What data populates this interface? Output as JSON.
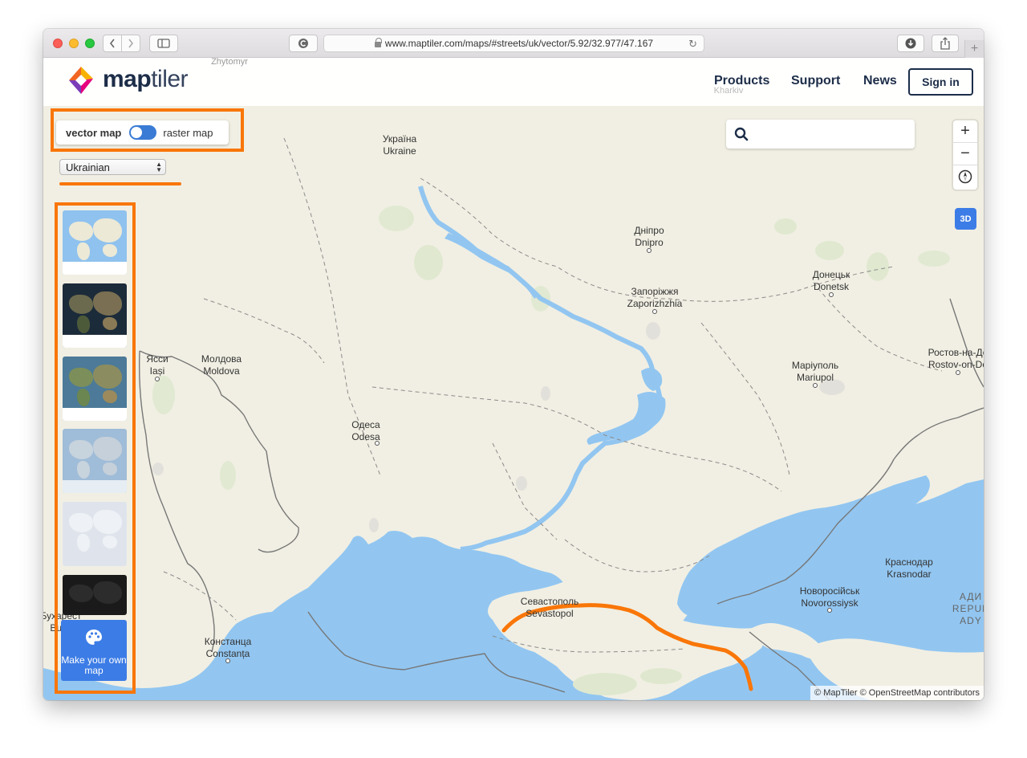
{
  "browser": {
    "url": "www.maptiler.com/maps/#streets/uk/vector/5.92/32.977/47.167"
  },
  "header": {
    "logo_text_bold": "map",
    "logo_text_light": "tiler",
    "nav": [
      "Products",
      "Support",
      "News"
    ],
    "signin_label": "Sign in"
  },
  "controls": {
    "vector_label": "vector map",
    "raster_label": "raster map",
    "language_value": "Ukrainian",
    "make_map_label": "Make your own map",
    "btn_3d": "3D",
    "zoom_in": "+",
    "zoom_out": "−",
    "attribution": "© MapTiler © OpenStreetMap contributors"
  },
  "map_labels": {
    "zhytomyr": "Zhytomyr",
    "kharkiv": "Kharkiv",
    "ukraine_uk": "Україна",
    "ukraine_en": "Ukraine",
    "dnipro_uk": "Дніпро",
    "dnipro_en": "Dnipro",
    "zaporizhzhia_uk": "Запоріжжя",
    "zaporizhzhia_en": "Zaporizhzhia",
    "donetsk_uk": "Донецьк",
    "donetsk_en": "Donetsk",
    "iasi_uk": "Ясси",
    "iasi_en": "Iași",
    "moldova_uk": "Молдова",
    "moldova_en": "Moldova",
    "mariupol_uk": "Маріуполь",
    "mariupol_en": "Mariupol",
    "rostov_uk": "Ростов-на-До",
    "rostov_en": "Rostov-on-Do",
    "odesa_uk": "Одеса",
    "odesa_en": "Odesa",
    "sevastopol_uk": "Севастополь",
    "sevastopol_en": "Sevastopol",
    "krasnodar_uk": "Краснодар",
    "krasnodar_en": "Krasnodar",
    "novorossiysk_uk": "Новоросійськ",
    "novorossiysk_en": "Novorossiysk",
    "constanta_uk": "Констанца",
    "constanta_en": "Constanța",
    "bucharest_uk": "Бухарест",
    "bucharest_en": "Bucu",
    "adygea_1": "АДИ",
    "adygea_2": "REPUB",
    "adygea_3": "ADY"
  },
  "colors": {
    "highlight": "#f97608",
    "water": "#92c6f1",
    "land": "#f1efe3",
    "accent": "#3c7ce6"
  },
  "icons": [
    "back-icon",
    "forward-icon",
    "sidebar-icon",
    "extension-icon",
    "lock-icon",
    "reload-icon",
    "download-icon",
    "share-icon",
    "search-icon",
    "compass-icon",
    "palette-icon"
  ]
}
